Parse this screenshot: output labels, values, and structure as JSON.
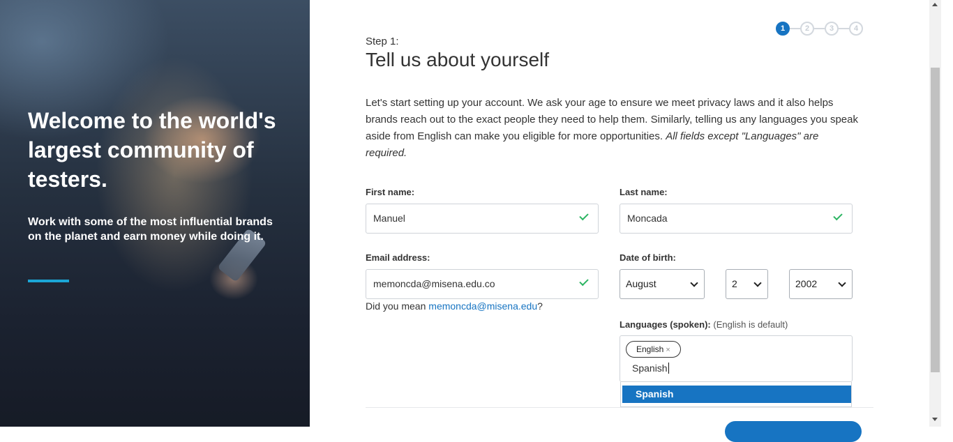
{
  "hero": {
    "title": "Welcome to the world's largest community of testers.",
    "subtitle": "Work with some of the most influential brands on the planet and earn money while doing it.",
    "accent_color": "#1ba6d6"
  },
  "stepper": {
    "steps": [
      "1",
      "2",
      "3",
      "4"
    ],
    "current_step": 1,
    "active_color": "#1774c2"
  },
  "form": {
    "step_label": "Step 1:",
    "title": "Tell us about yourself",
    "intro_text": "Let's start setting up your account. We ask your age to ensure we meet privacy laws and it also helps brands reach out to the exact people they need to help them. Similarly, telling us any languages you speak aside from English can make you eligible for more opportunities. ",
    "intro_emphasis": "All fields except \"Languages\" are required.",
    "first_name": {
      "label": "First name:",
      "value": "Manuel",
      "valid": true
    },
    "last_name": {
      "label": "Last name:",
      "value": "Moncada",
      "valid": true
    },
    "email": {
      "label": "Email address:",
      "value": "memoncda@misena.edu.co",
      "valid": true
    },
    "email_suggestion": {
      "prefix": "Did you mean ",
      "suggestion": "memoncda@misena.edu",
      "suffix": "?"
    },
    "date_of_birth": {
      "label": "Date of birth:",
      "month": "August",
      "day": "2",
      "year": "2002"
    },
    "languages": {
      "label": "Languages (spoken):",
      "hint": "(English is default)",
      "selected": [
        "English"
      ],
      "typed_value": "Spanish",
      "options": [
        "Spanish"
      ]
    }
  },
  "icons": {
    "valid": "check-icon",
    "remove_tag": "close-icon",
    "select": "chevron-down-icon"
  },
  "colors": {
    "valid_check": "#2db563",
    "link": "#1774c2",
    "highlight": "#1774c2"
  }
}
